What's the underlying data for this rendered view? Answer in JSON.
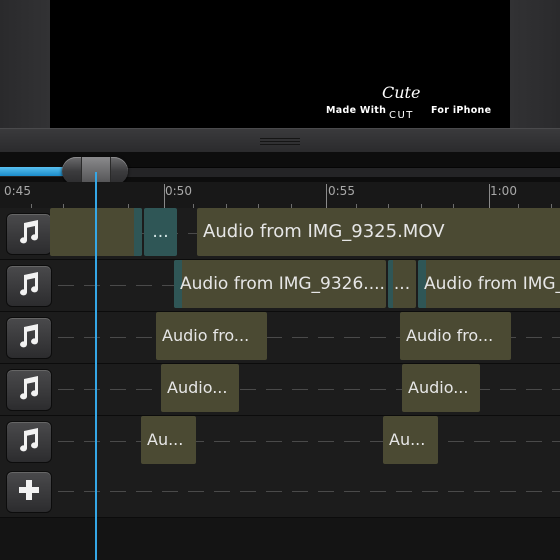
{
  "preview": {
    "watermark": {
      "made_with": "Made With",
      "cute": "Cute",
      "cut": "CUT",
      "for_iphone": "For iPhone"
    }
  },
  "scrubber": {
    "progress_percent": 13
  },
  "ruler": {
    "labels": [
      "0:45",
      "0:50",
      "0:55",
      "1:00"
    ]
  },
  "tracks": [
    {
      "icon": "music-note-icon",
      "clips": [
        {
          "label": "",
          "style": "olive"
        },
        {
          "label": "...",
          "style": "teal"
        },
        {
          "label": "Audio from IMG_9325.MOV",
          "style": "olive"
        }
      ]
    },
    {
      "icon": "music-note-icon",
      "clips": [
        {
          "label": "Audio from IMG_9326....",
          "style": "olive"
        },
        {
          "label": "...",
          "style": "olive"
        },
        {
          "label": "Audio from IMG_",
          "style": "olive"
        }
      ]
    },
    {
      "icon": "music-note-icon",
      "clips": [
        {
          "label": "Audio fro...",
          "style": "olive"
        },
        {
          "label": "Audio fro...",
          "style": "olive"
        }
      ]
    },
    {
      "icon": "music-note-icon",
      "clips": [
        {
          "label": "Audio...",
          "style": "olive"
        },
        {
          "label": "Audio...",
          "style": "olive"
        }
      ]
    },
    {
      "icon": "music-note-icon",
      "clips": [
        {
          "label": "Au...",
          "style": "olive"
        },
        {
          "label": "Au...",
          "style": "olive"
        }
      ]
    }
  ],
  "add_track": {
    "icon": "plus-icon"
  },
  "colors": {
    "accent": "#35a7e6",
    "clip": "#4b4a33",
    "clip_edge": "#2f5656"
  }
}
